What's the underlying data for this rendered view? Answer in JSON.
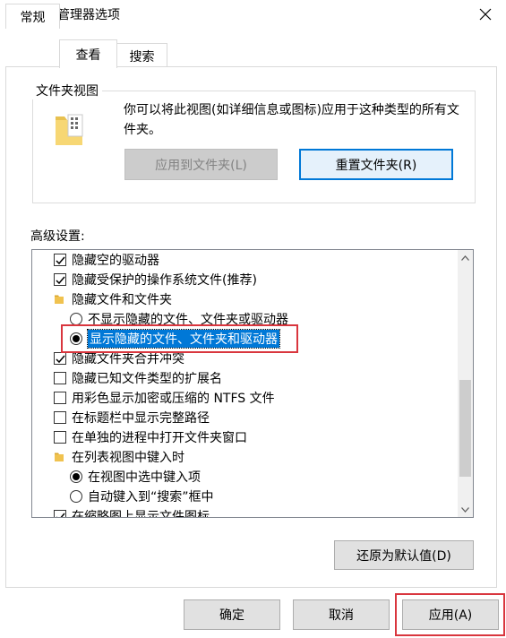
{
  "window": {
    "title": "文件资源管理器选项"
  },
  "tabs": [
    {
      "label": "常规",
      "active": false
    },
    {
      "label": "查看",
      "active": true
    },
    {
      "label": "搜索",
      "active": false
    }
  ],
  "folder_views": {
    "group_label": "文件夹视图",
    "description": "你可以将此视图(如详细信息或图标)应用于这种类型的所有文件夹。",
    "apply_button": "应用到文件夹(L)",
    "reset_button": "重置文件夹(R)"
  },
  "advanced": {
    "label": "高级设置:",
    "items": [
      {
        "kind": "checkbox",
        "checked": true,
        "label": "隐藏空的驱动器",
        "indent": 0
      },
      {
        "kind": "checkbox",
        "checked": true,
        "label": "隐藏受保护的操作系统文件(推荐)",
        "indent": 0
      },
      {
        "kind": "folder",
        "label": "隐藏文件和文件夹",
        "indent": 0
      },
      {
        "kind": "radio",
        "checked": false,
        "label": "不显示隐藏的文件、文件夹或驱动器",
        "indent": 1
      },
      {
        "kind": "radio",
        "checked": true,
        "label": "显示隐藏的文件、文件夹和驱动器",
        "indent": 1,
        "selected": true
      },
      {
        "kind": "checkbox",
        "checked": true,
        "label": "隐藏文件夹合并冲突",
        "indent": 0
      },
      {
        "kind": "checkbox",
        "checked": false,
        "label": "隐藏已知文件类型的扩展名",
        "indent": 0
      },
      {
        "kind": "checkbox",
        "checked": false,
        "label": "用彩色显示加密或压缩的 NTFS 文件",
        "indent": 0
      },
      {
        "kind": "checkbox",
        "checked": false,
        "label": "在标题栏中显示完整路径",
        "indent": 0
      },
      {
        "kind": "checkbox",
        "checked": false,
        "label": "在单独的进程中打开文件夹窗口",
        "indent": 0
      },
      {
        "kind": "folder",
        "label": "在列表视图中键入时",
        "indent": 0
      },
      {
        "kind": "radio",
        "checked": true,
        "label": "在视图中选中键入项",
        "indent": 1
      },
      {
        "kind": "radio",
        "checked": false,
        "label": "自动键入到“搜索”框中",
        "indent": 1
      },
      {
        "kind": "checkbox",
        "checked": true,
        "label": "在缩略图上显示文件图标",
        "indent": 0
      }
    ],
    "restore_button": "还原为默认值(D)"
  },
  "footer": {
    "ok_button": "确定",
    "cancel_button": "取消",
    "apply_button": "应用(A)"
  },
  "colors": {
    "accent": "#0078d7",
    "highlight_box": "#d9363e"
  }
}
